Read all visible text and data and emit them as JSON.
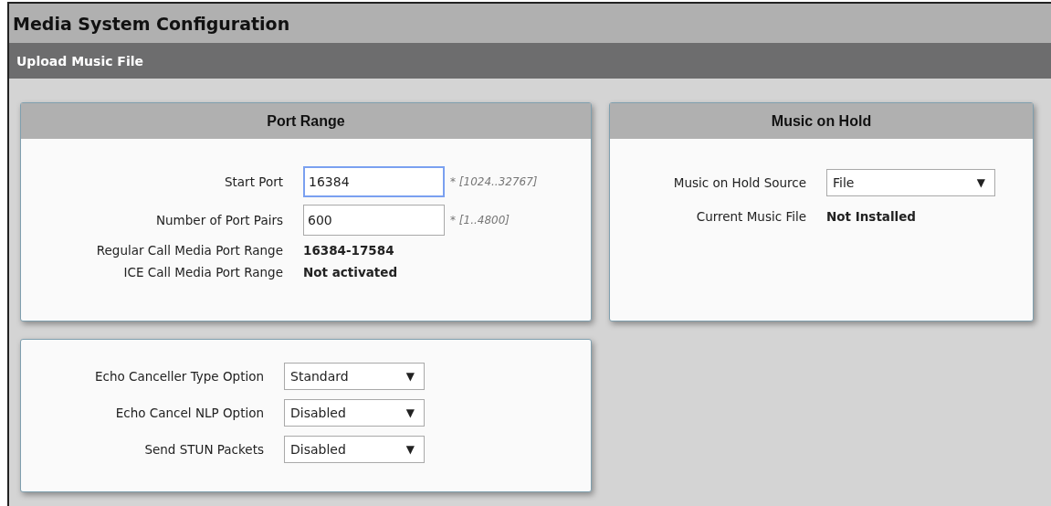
{
  "window": {
    "title": "Media System Configuration"
  },
  "subheader": {
    "title": "Upload Music File"
  },
  "panels": [
    {
      "title": "Port Range",
      "rows": [
        {
          "kind": "input",
          "label": "Start Port",
          "value": "16384",
          "hint": "* [1024..32767]",
          "focused": true
        },
        {
          "kind": "input",
          "label": "Number of Port Pairs",
          "value": "600",
          "hint": "* [1..4800]",
          "focused": false
        },
        {
          "kind": "text",
          "label": "Regular Call Media Port Range",
          "value": "16384-17584"
        },
        {
          "kind": "text",
          "label": "ICE Call Media Port Range",
          "value": "Not activated"
        }
      ]
    },
    {
      "title": "Music on Hold",
      "rows": [
        {
          "kind": "select",
          "label": "Music on Hold Source",
          "value": "File",
          "arrow": "▼"
        },
        {
          "kind": "text",
          "label": "Current Music File",
          "value": "Not Installed"
        }
      ]
    },
    {
      "rows": [
        {
          "kind": "select",
          "label": "Echo Canceller Type Option",
          "value": "Standard",
          "arrow": "▼"
        },
        {
          "kind": "select",
          "label": "Echo Cancel NLP Option",
          "value": "Disabled",
          "arrow": "▼"
        },
        {
          "kind": "select",
          "label": "Send STUN Packets",
          "value": "Disabled",
          "arrow": "▼"
        }
      ]
    }
  ]
}
